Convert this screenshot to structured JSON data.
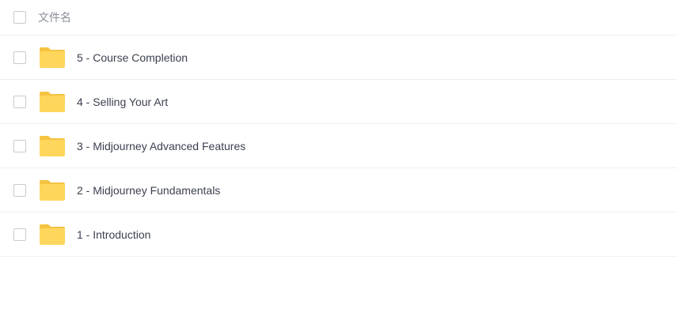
{
  "header": {
    "column_label": "文件名"
  },
  "files": [
    {
      "name": "5 - Course Completion",
      "type": "folder",
      "icon": "folder-icon"
    },
    {
      "name": "4 - Selling Your Art",
      "type": "folder",
      "icon": "folder-icon"
    },
    {
      "name": "3 - Midjourney Advanced Features",
      "type": "folder",
      "icon": "folder-icon"
    },
    {
      "name": "2 - Midjourney Fundamentals",
      "type": "folder",
      "icon": "folder-icon"
    },
    {
      "name": "1 - Introduction",
      "type": "folder",
      "icon": "folder-icon"
    }
  ],
  "colors": {
    "folder": "#FFD65C",
    "folder_tab": "#F5C342",
    "text": "#3C4150",
    "header_text": "#8A8F99",
    "divider": "#F0F0F2",
    "checkbox_border": "#C7CAD1"
  }
}
